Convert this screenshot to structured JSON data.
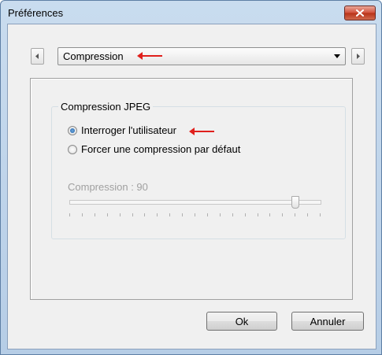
{
  "window": {
    "title": "Préférences"
  },
  "toolbar": {
    "section_selected": "Compression"
  },
  "group": {
    "legend": "Compression JPEG",
    "options": [
      {
        "label": "Interroger l'utilisateur",
        "checked": true
      },
      {
        "label": "Forcer une compression par défaut",
        "checked": false
      }
    ],
    "slider": {
      "label": "Compression : 90",
      "value": 90,
      "min": 0,
      "max": 100,
      "enabled": false
    }
  },
  "buttons": {
    "ok": "Ok",
    "cancel": "Annuler"
  },
  "colors": {
    "annotation_arrow": "#e0201c",
    "close_button": "#d1503a"
  },
  "icons": {
    "close": "close-icon",
    "prev": "triangle-left-icon",
    "next": "triangle-right-icon",
    "dropdown": "chevron-down-icon",
    "annotation": "red-arrow-icon"
  }
}
